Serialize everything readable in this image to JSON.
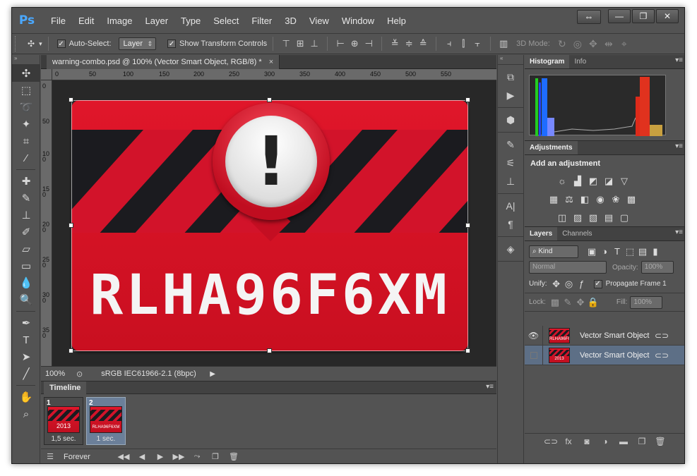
{
  "app": {
    "logo": "Ps",
    "menu": [
      "File",
      "Edit",
      "Image",
      "Layer",
      "Type",
      "Select",
      "Filter",
      "3D",
      "View",
      "Window",
      "Help"
    ],
    "window_controls": [
      "—",
      "❐",
      "✕"
    ]
  },
  "options_bar": {
    "auto_select_label": "Auto-Select:",
    "auto_select_checked": true,
    "auto_select_target": "Layer",
    "show_transform_label": "Show Transform Controls",
    "show_transform_checked": true,
    "mode_3d_label": "3D Mode:"
  },
  "document": {
    "tab_title": "warning-combo.psd @ 100% (Vector Smart Object, RGB/8) *",
    "close_glyph": "×",
    "ruler_top": [
      "0",
      "50",
      "100",
      "150",
      "200",
      "250",
      "300",
      "350",
      "400",
      "450",
      "500",
      "550"
    ],
    "ruler_left": [
      "0",
      "50",
      "100",
      "150",
      "200",
      "250",
      "300",
      "350"
    ],
    "artwork": {
      "exclamation": "!",
      "code": "RLHA96F6XM"
    },
    "zoom": "100%",
    "color_profile": "sRGB IEC61966-2.1 (8bpc)"
  },
  "timeline": {
    "tab": "Timeline",
    "frames": [
      {
        "number": "1",
        "thumb_text": "2013",
        "delay": "1,5 sec.",
        "selected": false
      },
      {
        "number": "2",
        "thumb_text": "RLHA96F6XM",
        "delay": "1 sec.",
        "selected": true
      }
    ],
    "loop": "Forever"
  },
  "panels": {
    "histogram_tabs": [
      "Histogram",
      "Info"
    ],
    "adjustments_tab": "Adjustments",
    "adjustments_title": "Add an adjustment",
    "layers_tabs": [
      "Layers",
      "Channels"
    ],
    "filter_kind": "Kind",
    "blend_mode": "Normal",
    "opacity_label": "Opacity:",
    "opacity_value": "100%",
    "unify_label": "Unify:",
    "propagate_label": "Propagate Frame 1",
    "propagate_checked": true,
    "lock_label": "Lock:",
    "fill_label": "Fill:",
    "fill_value": "100%",
    "layers": [
      {
        "name": "Vector Smart Object",
        "thumb_text": "RLHA96F6XM",
        "visible": true,
        "selected": false
      },
      {
        "name": "Vector Smart Object",
        "thumb_text": "2013",
        "visible": false,
        "selected": true
      }
    ]
  },
  "colors": {
    "card_red": "#d8142a",
    "stripe_dark": "#1b1b1f",
    "panel_bg": "#535353",
    "selection_blue": "#5d6f86"
  }
}
